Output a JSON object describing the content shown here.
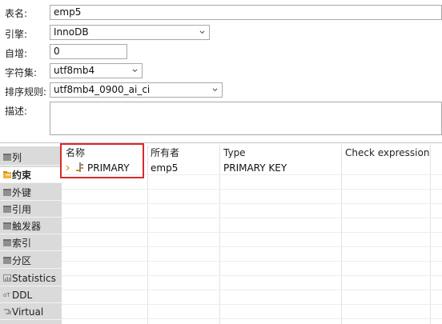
{
  "form": {
    "table_name_label": "表名:",
    "table_name_value": "emp5",
    "engine_label": "引擎:",
    "engine_value": "InnoDB",
    "auto_inc_label": "自增:",
    "auto_inc_value": "0",
    "charset_label": "字符集:",
    "charset_value": "utf8mb4",
    "collation_label": "排序规则:",
    "collation_value": "utf8mb4_0900_ai_ci",
    "comment_label": "描述:",
    "comment_value": ""
  },
  "sidebar": {
    "items": [
      {
        "label": "列",
        "icon": "table-icon",
        "active": false
      },
      {
        "label": "约束",
        "icon": "constraint-icon",
        "active": true
      },
      {
        "label": "外键",
        "icon": "table-icon",
        "active": false
      },
      {
        "label": "引用",
        "icon": "table-icon",
        "active": false
      },
      {
        "label": "触发器",
        "icon": "table-icon",
        "active": false
      },
      {
        "label": "索引",
        "icon": "table-icon",
        "active": false
      },
      {
        "label": "分区",
        "icon": "table-icon",
        "active": false
      },
      {
        "label": "Statistics",
        "icon": "statistics-icon",
        "active": false
      },
      {
        "label": "DDL",
        "icon": "ddl-icon",
        "active": false
      },
      {
        "label": "Virtual",
        "icon": "virtual-icon",
        "active": false
      }
    ]
  },
  "grid": {
    "headers": [
      "名称",
      "所有者",
      "Type",
      "Check expression"
    ],
    "rows": [
      {
        "name": "PRIMARY",
        "owner": "emp5",
        "type": "PRIMARY KEY",
        "check": ""
      }
    ]
  },
  "colors": {
    "highlight": "#d62b2b",
    "sidebar_bg": "#dadada",
    "key_icon": "#d98a1a"
  }
}
